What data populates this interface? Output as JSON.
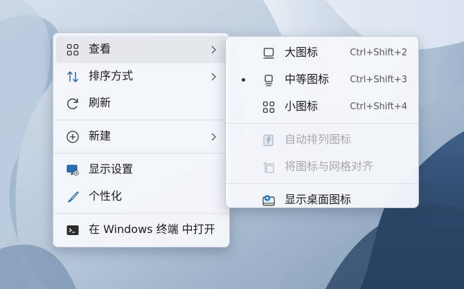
{
  "main_menu": {
    "items": [
      {
        "label": "查看",
        "icon": "grid-icon",
        "has_submenu": true
      },
      {
        "label": "排序方式",
        "icon": "sort-icon",
        "has_submenu": true
      },
      {
        "label": "刷新",
        "icon": "refresh-icon"
      },
      {
        "label": "新建",
        "icon": "new-icon",
        "has_submenu": true
      },
      {
        "label": "显示设置",
        "icon": "display-settings-icon"
      },
      {
        "label": "个性化",
        "icon": "brush-icon"
      },
      {
        "label": "在 Windows 终端 中打开",
        "icon": "terminal-icon"
      }
    ]
  },
  "view_submenu": {
    "items": [
      {
        "label": "大图标",
        "shortcut": "Ctrl+Shift+2",
        "icon": "large-icons-icon"
      },
      {
        "label": "中等图标",
        "shortcut": "Ctrl+Shift+3",
        "icon": "medium-icons-icon",
        "selected": true
      },
      {
        "label": "小图标",
        "shortcut": "Ctrl+Shift+4",
        "icon": "small-icons-icon"
      },
      {
        "label": "自动排列图标",
        "icon": "auto-arrange-icon",
        "disabled": true
      },
      {
        "label": "将图标与网格对齐",
        "icon": "align-grid-icon",
        "disabled": true
      },
      {
        "label": "显示桌面图标",
        "icon": "show-desktop-icons-icon"
      }
    ]
  },
  "colors": {
    "accent": "#005fb8",
    "menu_bg": "#f4f6fa",
    "disabled": "#a6a8ad"
  }
}
